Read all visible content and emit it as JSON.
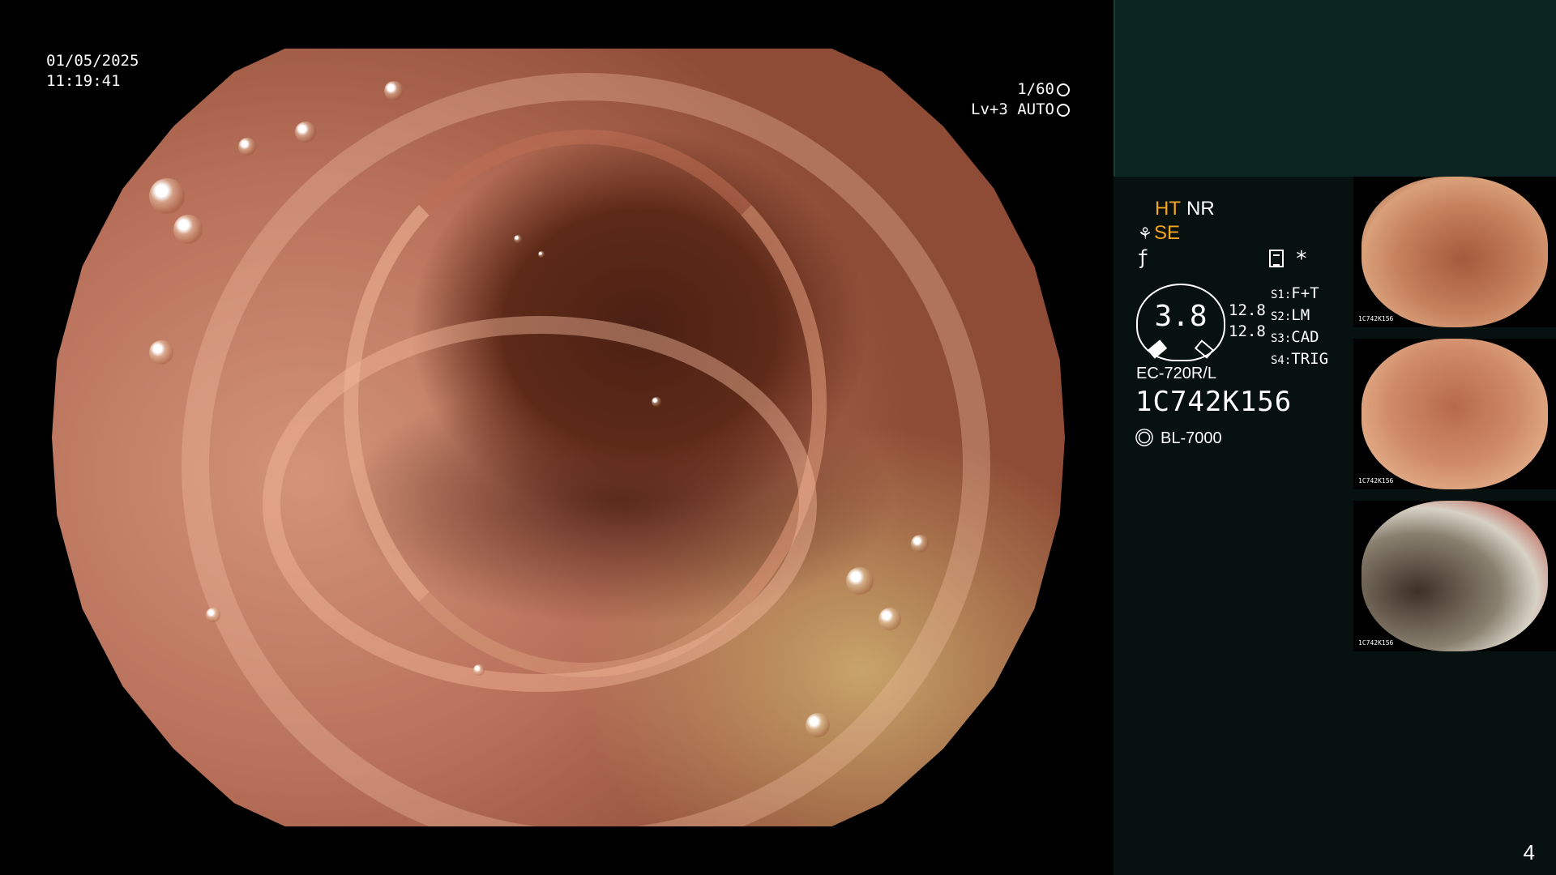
{
  "overlay": {
    "date": "01/05/2025",
    "time": "11:19:41",
    "shutter": "1/60",
    "level": "Lv+3 AUTO"
  },
  "side_panel": {
    "ht": "HT",
    "nr": "NR",
    "se": "SE",
    "gauge_value": "3.8",
    "gauge_left_top": "12.8",
    "gauge_left_bottom": "12.8",
    "switches": [
      {
        "key": "S1:",
        "value": "F+T"
      },
      {
        "key": "S2:",
        "value": "LM"
      },
      {
        "key": "S3:",
        "value": "CAD"
      },
      {
        "key": "S4:",
        "value": "TRIG"
      }
    ],
    "scope_model": "EC-720R/L",
    "serial": "1C742K156",
    "light_source": "BL-7000",
    "thumb_labels": [
      "1C742K156",
      "1C742K156",
      "1C742K156"
    ]
  },
  "page_number": "4"
}
